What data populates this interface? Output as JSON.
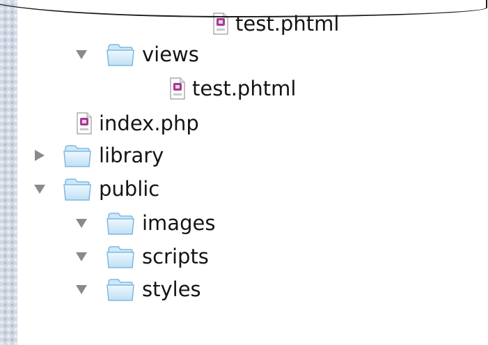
{
  "file_tree": {
    "rows": [
      {
        "label": "test.phtml",
        "type": "file",
        "depth": 3,
        "expanded": null
      },
      {
        "label": "views",
        "type": "folder",
        "depth": 2,
        "expanded": true
      },
      {
        "label": "test.phtml",
        "type": "file",
        "depth": 3,
        "expanded": null
      },
      {
        "label": "index.php",
        "type": "file",
        "depth": 1,
        "expanded": null
      },
      {
        "label": "library",
        "type": "folder",
        "depth": 0,
        "expanded": false
      },
      {
        "label": "public",
        "type": "folder",
        "depth": 0,
        "expanded": true
      },
      {
        "label": "images",
        "type": "folder",
        "depth": 1,
        "expanded": true
      },
      {
        "label": "scripts",
        "type": "folder",
        "depth": 1,
        "expanded": true
      },
      {
        "label": "styles",
        "type": "folder",
        "depth": 1,
        "expanded": true
      }
    ]
  },
  "icons": {
    "folder": "folder-icon",
    "file": "php-file-icon",
    "expanded": "disclosure-triangle-down-icon",
    "collapsed": "disclosure-triangle-right-icon"
  },
  "colors": {
    "folder_light": "#dff0fb",
    "folder_dark": "#7fb9e0",
    "file_accent": "#8a2a7a",
    "triangle": "#8a8a8a",
    "sidebar_strip": "#d3d9e4"
  }
}
